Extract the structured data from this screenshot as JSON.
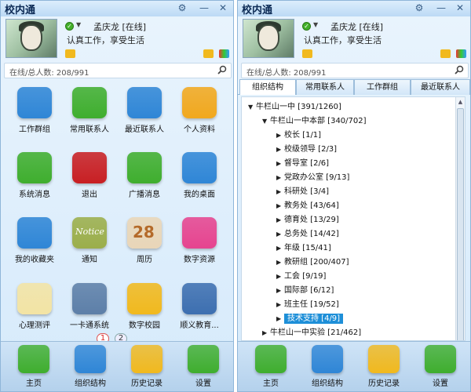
{
  "left": {
    "title": "校内通",
    "user_name": "孟庆龙 [在线]",
    "motto": "认真工作，享受生活",
    "online": "在线/总人数: 208/991",
    "grid": [
      {
        "label": "工作群组",
        "icon": "work-group-icon",
        "color": "#2f86d6"
      },
      {
        "label": "常用联系人",
        "icon": "contacts-icon",
        "color": "#3fae2e"
      },
      {
        "label": "最近联系人",
        "icon": "recent-contacts-icon",
        "color": "#2f86d6"
      },
      {
        "label": "个人资料",
        "icon": "profile-icon",
        "color": "#f1a81e"
      },
      {
        "label": "系统消息",
        "icon": "system-message-icon",
        "color": "#3fae2e"
      },
      {
        "label": "退出",
        "icon": "power-icon",
        "color": "#c81f23"
      },
      {
        "label": "广播消息",
        "icon": "broadcast-icon",
        "color": "#3fae2e"
      },
      {
        "label": "我的桌面",
        "icon": "desktop-icon",
        "color": "#2f86d6"
      },
      {
        "label": "我的收藏夹",
        "icon": "star-icon",
        "color": "#2f86d6"
      },
      {
        "label": "通知",
        "icon": "notice-icon",
        "color": "#9bae4a"
      },
      {
        "label": "周历",
        "icon": "calendar-icon",
        "color": "#e9d6b8"
      },
      {
        "label": "数字资源",
        "icon": "digital-resource-icon",
        "color": "#e6448f"
      },
      {
        "label": "心理测评",
        "icon": "checklist-icon",
        "color": "#f3e4a4"
      },
      {
        "label": "一卡通系统",
        "icon": "card-system-icon",
        "color": "#5d7fa8"
      },
      {
        "label": "数字校园",
        "icon": "house-icon",
        "color": "#f1b91e"
      },
      {
        "label": "顺义教育...",
        "icon": "education-site-icon",
        "color": "#3d6fb0"
      }
    ],
    "pages": [
      "1",
      "2"
    ],
    "notice_text": "Notice",
    "calendar_number": "28"
  },
  "right": {
    "title": "校内通",
    "user_name": "孟庆龙 [在线]",
    "motto": "认真工作，享受生活",
    "online": "在线/总人数: 208/991",
    "tabs": [
      "组织结构",
      "常用联系人",
      "工作群组",
      "最近联系人"
    ],
    "tree": [
      {
        "label": "牛栏山一中 [391/1260]",
        "depth": 0,
        "expanded": true
      },
      {
        "label": "牛栏山一中本部 [340/702]",
        "depth": 1,
        "expanded": true
      },
      {
        "label": "校长 [1/1]",
        "depth": 2
      },
      {
        "label": "校级领导 [2/3]",
        "depth": 2
      },
      {
        "label": "督导室 [2/6]",
        "depth": 2
      },
      {
        "label": "党政办公室 [9/13]",
        "depth": 2
      },
      {
        "label": "科研处 [3/4]",
        "depth": 2
      },
      {
        "label": "教务处 [43/64]",
        "depth": 2
      },
      {
        "label": "德育处 [13/29]",
        "depth": 2
      },
      {
        "label": "总务处 [14/42]",
        "depth": 2
      },
      {
        "label": "年级 [15/41]",
        "depth": 2
      },
      {
        "label": "教研组 [200/407]",
        "depth": 2
      },
      {
        "label": "工会 [9/19]",
        "depth": 2
      },
      {
        "label": "国际部 [6/12]",
        "depth": 2
      },
      {
        "label": "班主任 [19/52]",
        "depth": 2
      },
      {
        "label": "技术支持 [4/9]",
        "depth": 2,
        "selected": true
      },
      {
        "label": "牛栏山一中实验 [21/462]",
        "depth": 1,
        "expanded": false
      }
    ]
  },
  "dock": [
    {
      "label": "主页",
      "icon": "home-icon",
      "color": "#3fae2e"
    },
    {
      "label": "组织结构",
      "icon": "organization-icon",
      "color": "#2f86d6"
    },
    {
      "label": "历史记录",
      "icon": "history-icon",
      "color": "#f1b91e"
    },
    {
      "label": "设置",
      "icon": "settings-icon",
      "color": "#3fae2e"
    }
  ],
  "colors": {
    "accent": "#1e8fd8",
    "panel_bg": "#d6eafb",
    "title_text": "#0c2a55"
  }
}
